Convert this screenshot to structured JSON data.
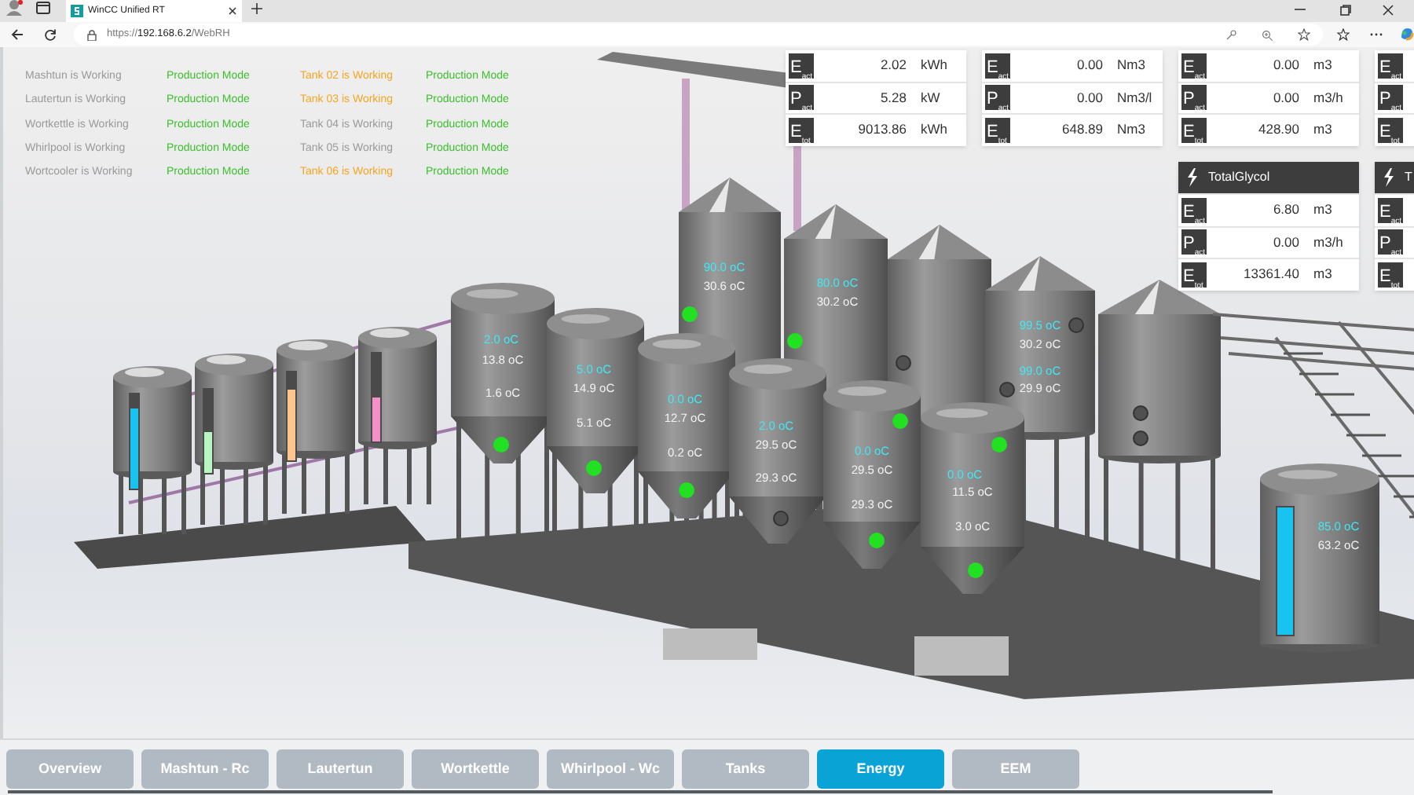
{
  "browser": {
    "tab_title": "WinCC Unified RT",
    "url": "https://**192.168.6.2**/WebRH"
  },
  "status_table": {
    "rows": [
      {
        "unit": "Mashtun is Working",
        "mode": "Production Mode",
        "tank": {
          "text": "Tank 02 is Working",
          "color": "#f5a623"
        },
        "tank_mode": "Production Mode"
      },
      {
        "unit": "Lautertun is Working",
        "mode": "Production Mode",
        "tank": {
          "text": "Tank 03 is Working",
          "color": "#f5a623"
        },
        "tank_mode": "Production Mode"
      },
      {
        "unit": "Wortkettle is Working",
        "mode": "Production Mode",
        "tank": {
          "text": "Tank 04 is Working",
          "color": "#9a9a9a"
        },
        "tank_mode": "Production Mode"
      },
      {
        "unit": "Whirlpool is Working",
        "mode": "Production Mode",
        "tank": {
          "text": "Tank 05 is Working",
          "color": "#9a9a9a"
        },
        "tank_mode": "Production Mode"
      },
      {
        "unit": "Wortcooler is Working",
        "mode": "Production Mode",
        "tank": {
          "text": "Tank 06 is Working",
          "color": "#f5a623"
        },
        "tank_mode": "Production Mode"
      }
    ]
  },
  "energy_cards_top": [
    {
      "rows": [
        {
          "symbol": "E$_{act}$",
          "value": "2.02",
          "unit": "kWh"
        },
        {
          "symbol": "P$_{act}$",
          "value": "5.28",
          "unit": "kW"
        },
        {
          "symbol": "E$_{tot}$",
          "value": "9013.86",
          "unit": "kWh"
        }
      ]
    },
    {
      "rows": [
        {
          "symbol": "E$_{act}$",
          "value": "0.00",
          "unit": "Nm3"
        },
        {
          "symbol": "P$_{act}$",
          "value": "0.00",
          "unit": "Nm3/l"
        },
        {
          "symbol": "E$_{tot}$",
          "value": "648.89",
          "unit": "Nm3"
        }
      ]
    },
    {
      "rows": [
        {
          "symbol": "E$_{act}$",
          "value": "0.00",
          "unit": "m3"
        },
        {
          "symbol": "P$_{act}$",
          "value": "0.00",
          "unit": "m3/h"
        },
        {
          "symbol": "E$_{tot}$",
          "value": "428.90",
          "unit": "m3"
        }
      ]
    },
    {
      "rows": [
        {
          "symbol": "E$_{act}$"
        },
        {
          "symbol": "P$_{act}$"
        },
        {
          "symbol": "E$_{tot}$"
        }
      ]
    }
  ],
  "energy_cards_bottom": [
    {
      "title": "TotalGlycol",
      "rows": [
        {
          "symbol": "E$_{act}$",
          "value": "6.80",
          "unit": "m3"
        },
        {
          "symbol": "P$_{act}$",
          "value": "0.00",
          "unit": "m3/h"
        },
        {
          "symbol": "E$_{tot}$",
          "value": "13361.40",
          "unit": "m3"
        }
      ]
    },
    {
      "title": "T",
      "rows": [
        {
          "symbol": "E$_{act}$"
        },
        {
          "symbol": "P$_{act}$"
        },
        {
          "symbol": "E$_{tot}$"
        }
      ]
    }
  ],
  "plant": {
    "vessels": [
      {
        "level": 0.85,
        "color": "#19c3f0"
      },
      {
        "level": 0.5,
        "color": "#b8f5c0"
      },
      {
        "level": 0.8,
        "color": "#ffc58f"
      },
      {
        "level": 0.5,
        "color": "#f48fc8"
      }
    ],
    "tanks": [
      {
        "labels": [
          {
            "text": "2.0 oC",
            "kind": "setpoint"
          },
          {
            "text": "13.8 oC",
            "kind": "actual"
          },
          {
            "text": "1.6 oC",
            "kind": "actual"
          }
        ],
        "lamps": [
          {
            "on": true
          }
        ]
      },
      {
        "labels": [
          {
            "text": "5.0 oC",
            "kind": "setpoint"
          },
          {
            "text": "14.9 oC",
            "kind": "actual"
          },
          {
            "text": "5.1 oC",
            "kind": "actual"
          }
        ],
        "lamps": [
          {
            "on": true
          }
        ]
      },
      {
        "labels": [
          {
            "text": "0.0 oC",
            "kind": "setpoint"
          },
          {
            "text": "12.7 oC",
            "kind": "actual"
          },
          {
            "text": "0.2 oC",
            "kind": "actual"
          }
        ],
        "lamps": [
          {
            "on": true
          }
        ]
      },
      {
        "labels": [
          {
            "text": "2.0 oC",
            "kind": "setpoint"
          },
          {
            "text": "29.5 oC",
            "kind": "actual"
          },
          {
            "text": "29.3 oC",
            "kind": "actual"
          }
        ],
        "lamps": [
          {
            "on": false
          }
        ]
      },
      {
        "labels": [
          {
            "text": "0.0 oC",
            "kind": "setpoint"
          },
          {
            "text": "29.5 oC",
            "kind": "actual"
          },
          {
            "text": "29.3 oC",
            "kind": "actual"
          }
        ],
        "lamps": [
          {
            "on": true
          },
          {
            "on": true
          }
        ]
      },
      {
        "labels": [
          {
            "text": "0.0 oC",
            "kind": "setpoint"
          },
          {
            "text": "11.5 oC",
            "kind": "actual"
          },
          {
            "text": "3.0 oC",
            "kind": "actual"
          }
        ],
        "lamps": [
          {
            "on": true
          },
          {
            "on": true
          }
        ]
      },
      {
        "labels": [
          {
            "text": "90.0 oC",
            "kind": "setpoint"
          },
          {
            "text": "30.6 oC",
            "kind": "actual"
          }
        ],
        "lamps": [
          {
            "on": true
          }
        ]
      },
      {
        "labels": [
          {
            "text": "80.0 oC",
            "kind": "setpoint"
          },
          {
            "text": "30.2 oC",
            "kind": "actual"
          }
        ],
        "lamps": [
          {
            "on": true
          }
        ]
      },
      {
        "lamps": [
          {
            "on": false
          }
        ]
      },
      {
        "labels": [
          {
            "text": "99.5 oC",
            "kind": "setpoint"
          },
          {
            "text": "30.2 oC",
            "kind": "actual"
          },
          {
            "text": "99.0 oC",
            "kind": "setpoint"
          },
          {
            "text": "29.9 oC",
            "kind": "actual"
          }
        ],
        "lamps": [
          {
            "on": false
          },
          {
            "on": false
          }
        ]
      },
      {
        "lamps": [
          {
            "on": false
          },
          {
            "on": false
          }
        ]
      },
      {
        "labels": [
          {
            "text": "85.0 oC",
            "kind": "setpoint"
          },
          {
            "text": "63.2 oC",
            "kind": "actual"
          }
        ],
        "level": 1
      }
    ]
  },
  "nav_tabs": [
    {
      "label": "Overview",
      "selected": false
    },
    {
      "label": "Mashtun - Rc",
      "selected": false
    },
    {
      "label": "Lautertun",
      "selected": false
    },
    {
      "label": "Wortkettle",
      "selected": false
    },
    {
      "label": "Whirlpool - Wc",
      "selected": false
    },
    {
      "label": "Tanks",
      "selected": false
    },
    {
      "label": "Energy",
      "selected": true
    },
    {
      "label": "EEM",
      "selected": false
    }
  ]
}
